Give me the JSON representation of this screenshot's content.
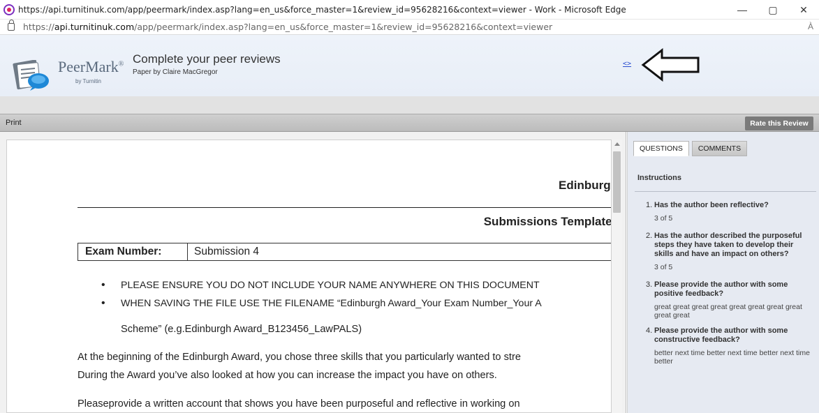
{
  "window": {
    "title": "https://api.turnitinuk.com/app/peermark/index.asp?lang=en_us&force_master=1&review_id=95628216&context=viewer - Work - Microsoft Edge",
    "minimize_glyph": "—",
    "maximize_glyph": "▢",
    "close_glyph": "✕"
  },
  "address_bar": {
    "url_prefix": "https://",
    "url_host": "api.turnitinuk.com",
    "url_path": "/app/peermark/index.asp?lang=en_us&force_master=1&review_id=95628216&context=viewer",
    "read_aloud_glyph": "À"
  },
  "header": {
    "brand": "PeerMark",
    "brand_mark": "®",
    "byline": "by Turnitin",
    "title": "Complete your peer reviews",
    "subtitle": "Paper by Claire MacGregor",
    "toggle_link": "<>"
  },
  "toolbar": {
    "print_label": "Print",
    "rate_label": "Rate this Review"
  },
  "document": {
    "title_line1": "Edinburgh",
    "title_line2": "Submissions Template -",
    "exam_label": "Exam Number:",
    "exam_value": "Submission 4",
    "bullets": [
      "PLEASE ENSURE YOU DO NOT INCLUDE YOUR NAME ANYWHERE ON THIS DOCUMENT",
      "WHEN SAVING THE FILE USE THE FILENAME “Edinburgh Award_Your Exam Number_Your A",
      "Scheme” (e.g.Edinburgh Award_B123456_LawPALS)"
    ],
    "para1_line1": "At the beginning of the Edinburgh Award, you chose three skills that you particularly wanted to stre",
    "para1_line2": "During the Award you’ve also looked at how you can increase the impact you have on others.",
    "para2_line1": "Pleaseprovide a written account that shows you have been purposeful and reflective in working on"
  },
  "panel": {
    "tabs": [
      "QUESTIONS",
      "COMMENTS"
    ],
    "instructions_label": "Instructions",
    "questions": [
      {
        "num": "1.",
        "text": "Has the author been reflective?",
        "answer": "3 of 5"
      },
      {
        "num": "2.",
        "text": "Has the author described the purposeful steps they have taken to develop their skills and have an impact on others?",
        "answer": "3 of 5"
      },
      {
        "num": "3.",
        "text": "Please provide the author with some positive feedback?",
        "answer": "great great great great great great great great great great"
      },
      {
        "num": "4.",
        "text": "Please provide the author with some constructive feedback?",
        "answer": "better next time better next time better next time better"
      }
    ]
  }
}
